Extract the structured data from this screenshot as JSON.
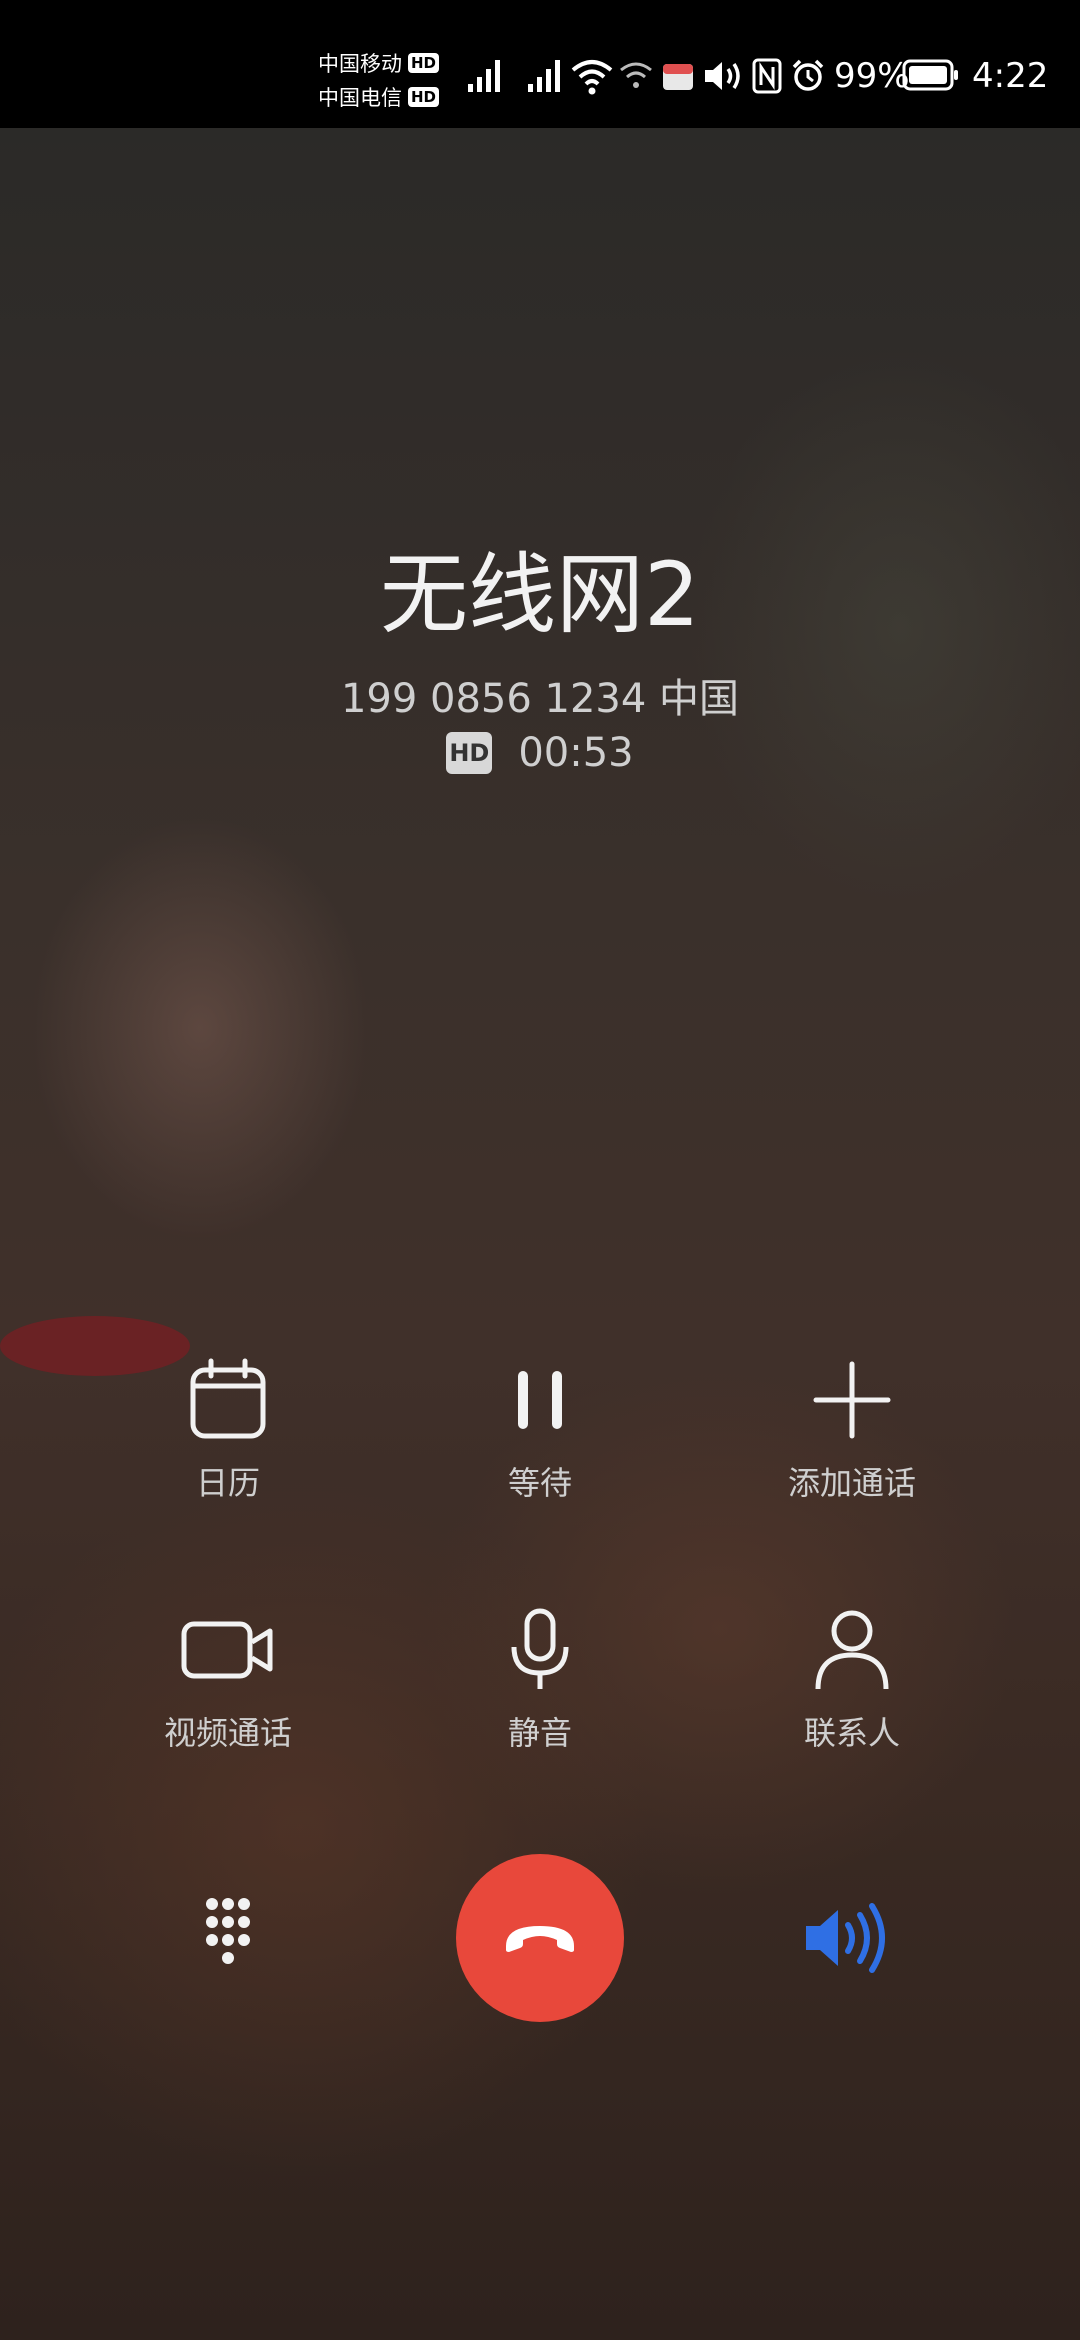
{
  "status_bar": {
    "carrier_1": "中国移动",
    "carrier_2": "中国电信",
    "hd_label": "HD",
    "battery_percent": "99%",
    "time": "4:22"
  },
  "call": {
    "name": "无线网2",
    "number": "199 0856 1234  中国",
    "hd_badge": "HD",
    "duration": "00:53"
  },
  "controls": {
    "calendar_label": "日历",
    "hold_label": "等待",
    "add_call_label": "添加通话",
    "video_call_label": "视频通话",
    "mute_label": "静音",
    "contacts_label": "联系人"
  },
  "colors": {
    "end_call": "#e8483b",
    "speaker_active": "#2f6fe4",
    "text_primary": "#f2f2f2",
    "text_secondary": "#cfcfcf"
  },
  "icons": {
    "dialpad": "dialpad-icon",
    "end_call": "end-call-icon",
    "speaker": "speaker-icon"
  }
}
